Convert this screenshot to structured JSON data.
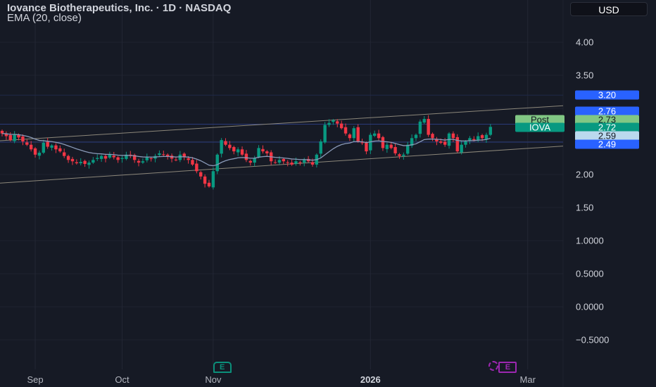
{
  "header": {
    "title": "Iovance Biotherapeutics, Inc. · 1D · NASDAQ",
    "indicator": "EMA (20, close)",
    "currency_button": "USD"
  },
  "colors": {
    "background": "#161a25",
    "up": "#089981",
    "down": "#f23645",
    "ema": "#8a9ab8",
    "channel": "#8c877a",
    "blue_badge": "#2962ff",
    "post_badge": "#81c784",
    "iova_badge": "#089981",
    "ema_badge": "#bbd9ee"
  },
  "chart_data": {
    "type": "candlestick",
    "title": "Iovance Biotherapeutics, Inc. · 1D · NASDAQ",
    "ylim": [
      -0.75,
      4.6
    ],
    "y_ticks": [
      "4.00",
      "3.50",
      "2.00",
      "1.50",
      "1.0000",
      "0.5000",
      "0.0000",
      "−0.5000"
    ],
    "y_tick_values": [
      4,
      3.5,
      2,
      1.5,
      1,
      0.5,
      0,
      -0.5
    ],
    "x_labels": [
      {
        "label": "Sep",
        "index": 8,
        "bold": false
      },
      {
        "label": "Oct",
        "index": 29,
        "bold": false
      },
      {
        "label": "Nov",
        "index": 51,
        "bold": false
      },
      {
        "label": "2026",
        "index": 89,
        "bold": true
      },
      {
        "label": "Mar",
        "index": 127,
        "bold": false
      }
    ],
    "closes": [
      2.62,
      2.58,
      2.52,
      2.6,
      2.56,
      2.5,
      2.45,
      2.38,
      2.3,
      2.33,
      2.48,
      2.42,
      2.44,
      2.38,
      2.35,
      2.28,
      2.22,
      2.2,
      2.17,
      2.19,
      2.16,
      2.18,
      2.22,
      2.25,
      2.28,
      2.24,
      2.3,
      2.26,
      2.22,
      2.25,
      2.3,
      2.28,
      2.22,
      2.18,
      2.2,
      2.26,
      2.24,
      2.28,
      2.32,
      2.3,
      2.27,
      2.24,
      2.22,
      2.3,
      2.26,
      2.22,
      2.15,
      2.05,
      1.97,
      1.86,
      1.82,
      2.05,
      2.3,
      2.52,
      2.45,
      2.4,
      2.35,
      2.38,
      2.3,
      2.22,
      2.18,
      2.25,
      2.4,
      2.35,
      2.32,
      2.2,
      2.18,
      2.22,
      2.2,
      2.18,
      2.15,
      2.2,
      2.18,
      2.22,
      2.2,
      2.15,
      2.3,
      2.5,
      2.75,
      2.78,
      2.82,
      2.77,
      2.7,
      2.62,
      2.55,
      2.7,
      2.5,
      2.48,
      2.35,
      2.6,
      2.62,
      2.55,
      2.4,
      2.45,
      2.4,
      2.32,
      2.28,
      2.3,
      2.45,
      2.55,
      2.6,
      2.8,
      2.84,
      2.6,
      2.55,
      2.5,
      2.48,
      2.45,
      2.62,
      2.55,
      2.35,
      2.45,
      2.5,
      2.55,
      2.52,
      2.58,
      2.55,
      2.6,
      2.72
    ],
    "ema_period": 20,
    "channel_upper": {
      "start": 2.51,
      "end": 3.04
    },
    "channel_lower": {
      "start": 1.87,
      "end": 2.43
    },
    "horizontal_lines": [
      2.76,
      2.49
    ],
    "price_badges": [
      {
        "value": "3.20",
        "price": 3.2,
        "kind": "blue"
      },
      {
        "value": "2.76",
        "price": 2.76,
        "kind": "blue"
      },
      {
        "value": "2.73",
        "price": 2.73,
        "kind": "post",
        "label": "Post"
      },
      {
        "value": "2.72",
        "price": 2.72,
        "kind": "iova",
        "label": "IOVA"
      },
      {
        "value": "2.59",
        "price": 2.59,
        "kind": "ema"
      },
      {
        "value": "2.49",
        "price": 2.49,
        "kind": "blue"
      }
    ],
    "events": [
      {
        "label": "E",
        "index": 53,
        "kind": "earnings-past"
      },
      {
        "label": "E",
        "index": 122,
        "kind": "earnings-upcoming"
      }
    ]
  }
}
